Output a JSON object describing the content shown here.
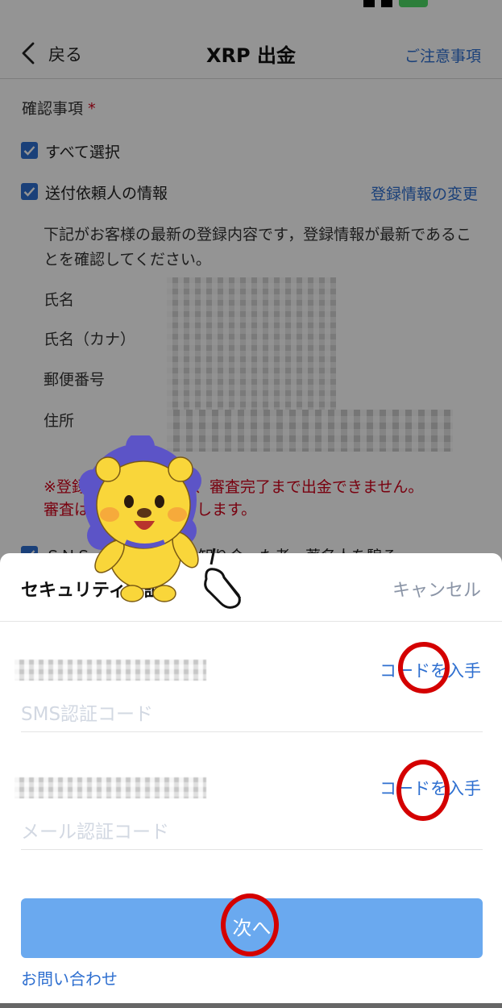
{
  "nav": {
    "back_label": "戻る",
    "title": "XRP 出金",
    "notes_link": "ご注意事項"
  },
  "confirm": {
    "section_title": "確認事項",
    "required_mark": "*",
    "select_all": "すべて選択",
    "sender_info": "送付依頼人の情報",
    "change_link": "登録情報の変更",
    "description": "下記がお客様の最新の登録内容です，登録情報が最新であることを確認してください。",
    "fields": [
      "氏名",
      "氏名（カナ）",
      "郵便番号",
      "住所"
    ],
    "warning_line1": "※登録　　　　　際は、審査完了まで出金できません。",
    "warning_line2": "審査は　　　　　完了します。",
    "sns_partial": "ＳＮＳ　　　　　等で知り合った者　著名人を騙る"
  },
  "sheet": {
    "title": "セキュリティ認証",
    "cancel": "キャンセル",
    "get_code_sms": "コードを入手",
    "sms_placeholder": "SMS認証コード",
    "get_code_mail": "コードを入手",
    "mail_placeholder": "メール認証コード",
    "next_button": "次へ",
    "contact_link": "お問い合わせ"
  },
  "colors": {
    "accent": "#2e6fd0",
    "button": "#6aa9ef",
    "warning": "#d0021b",
    "annotation": "#d40000"
  },
  "icons": [
    "back-chevron-icon",
    "checkbox-checked-icon",
    "lion-mascot",
    "pointing-hand-icon"
  ]
}
